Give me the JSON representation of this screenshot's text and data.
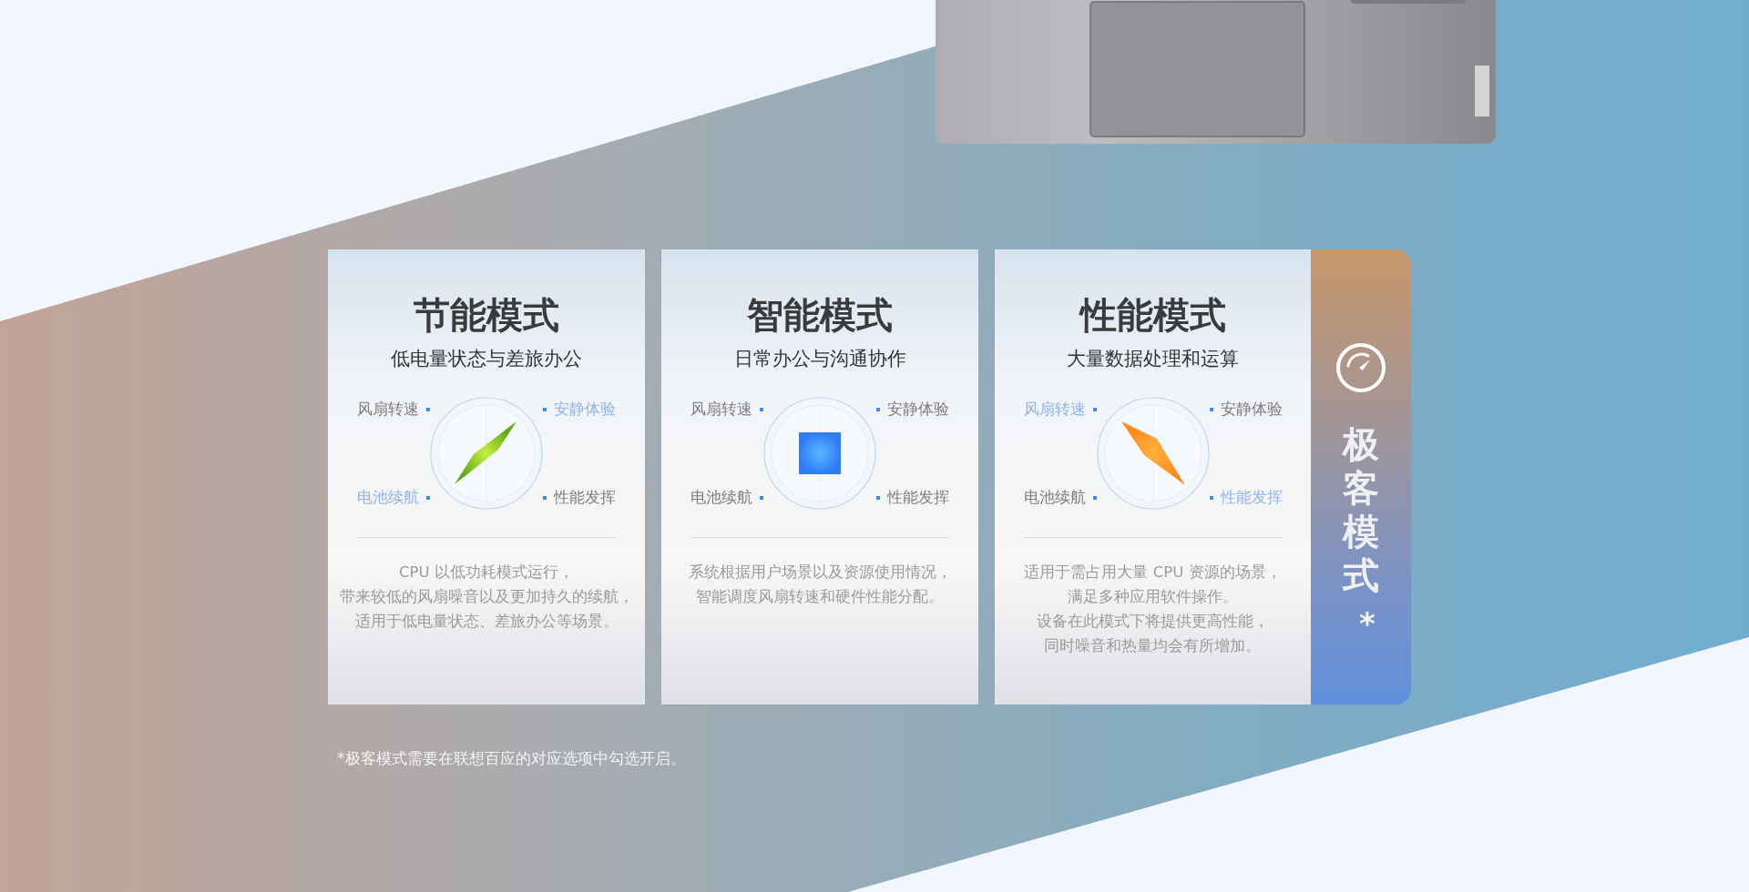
{
  "modes": [
    {
      "kind": "eco",
      "title": "节能模式",
      "subtitle": "低电量状态与差旅办公",
      "axes": [
        {
          "label": "风扇转速",
          "highlighted": false
        },
        {
          "label": "安静体验",
          "highlighted": true
        },
        {
          "label": "电池续航",
          "highlighted": true
        },
        {
          "label": "性能发挥",
          "highlighted": false
        }
      ],
      "description": [
        "CPU 以低功耗模式运行，",
        "带来较低的风扇噪音以及更加持久的续航，",
        "适用于低电量状态、差旅办公等场景。"
      ]
    },
    {
      "kind": "smart",
      "title": "智能模式",
      "subtitle": "日常办公与沟通协作",
      "axes": [
        {
          "label": "风扇转速",
          "highlighted": false
        },
        {
          "label": "安静体验",
          "highlighted": false
        },
        {
          "label": "电池续航",
          "highlighted": false
        },
        {
          "label": "性能发挥",
          "highlighted": false
        }
      ],
      "description": [
        "系统根据用户场景以及资源使用情况，",
        "智能调度风扇转速和硬件性能分配。"
      ]
    },
    {
      "kind": "performance",
      "title": "性能模式",
      "subtitle": "大量数据处理和运算",
      "axes": [
        {
          "label": "风扇转速",
          "highlighted": true
        },
        {
          "label": "安静体验",
          "highlighted": false
        },
        {
          "label": "电池续航",
          "highlighted": false
        },
        {
          "label": "性能发挥",
          "highlighted": true
        }
      ],
      "description": [
        "适用于需占用大量 CPU 资源的场景，",
        "满足多种应用软件操作。",
        "设备在此模式下将提供更高性能，",
        "同时噪音和热量均会有所增加。"
      ]
    }
  ],
  "geek_tab": {
    "title": "极客模式",
    "mark": "*"
  },
  "footnote": "*极客模式需要在联想百应的对应选项中勾选开启。"
}
